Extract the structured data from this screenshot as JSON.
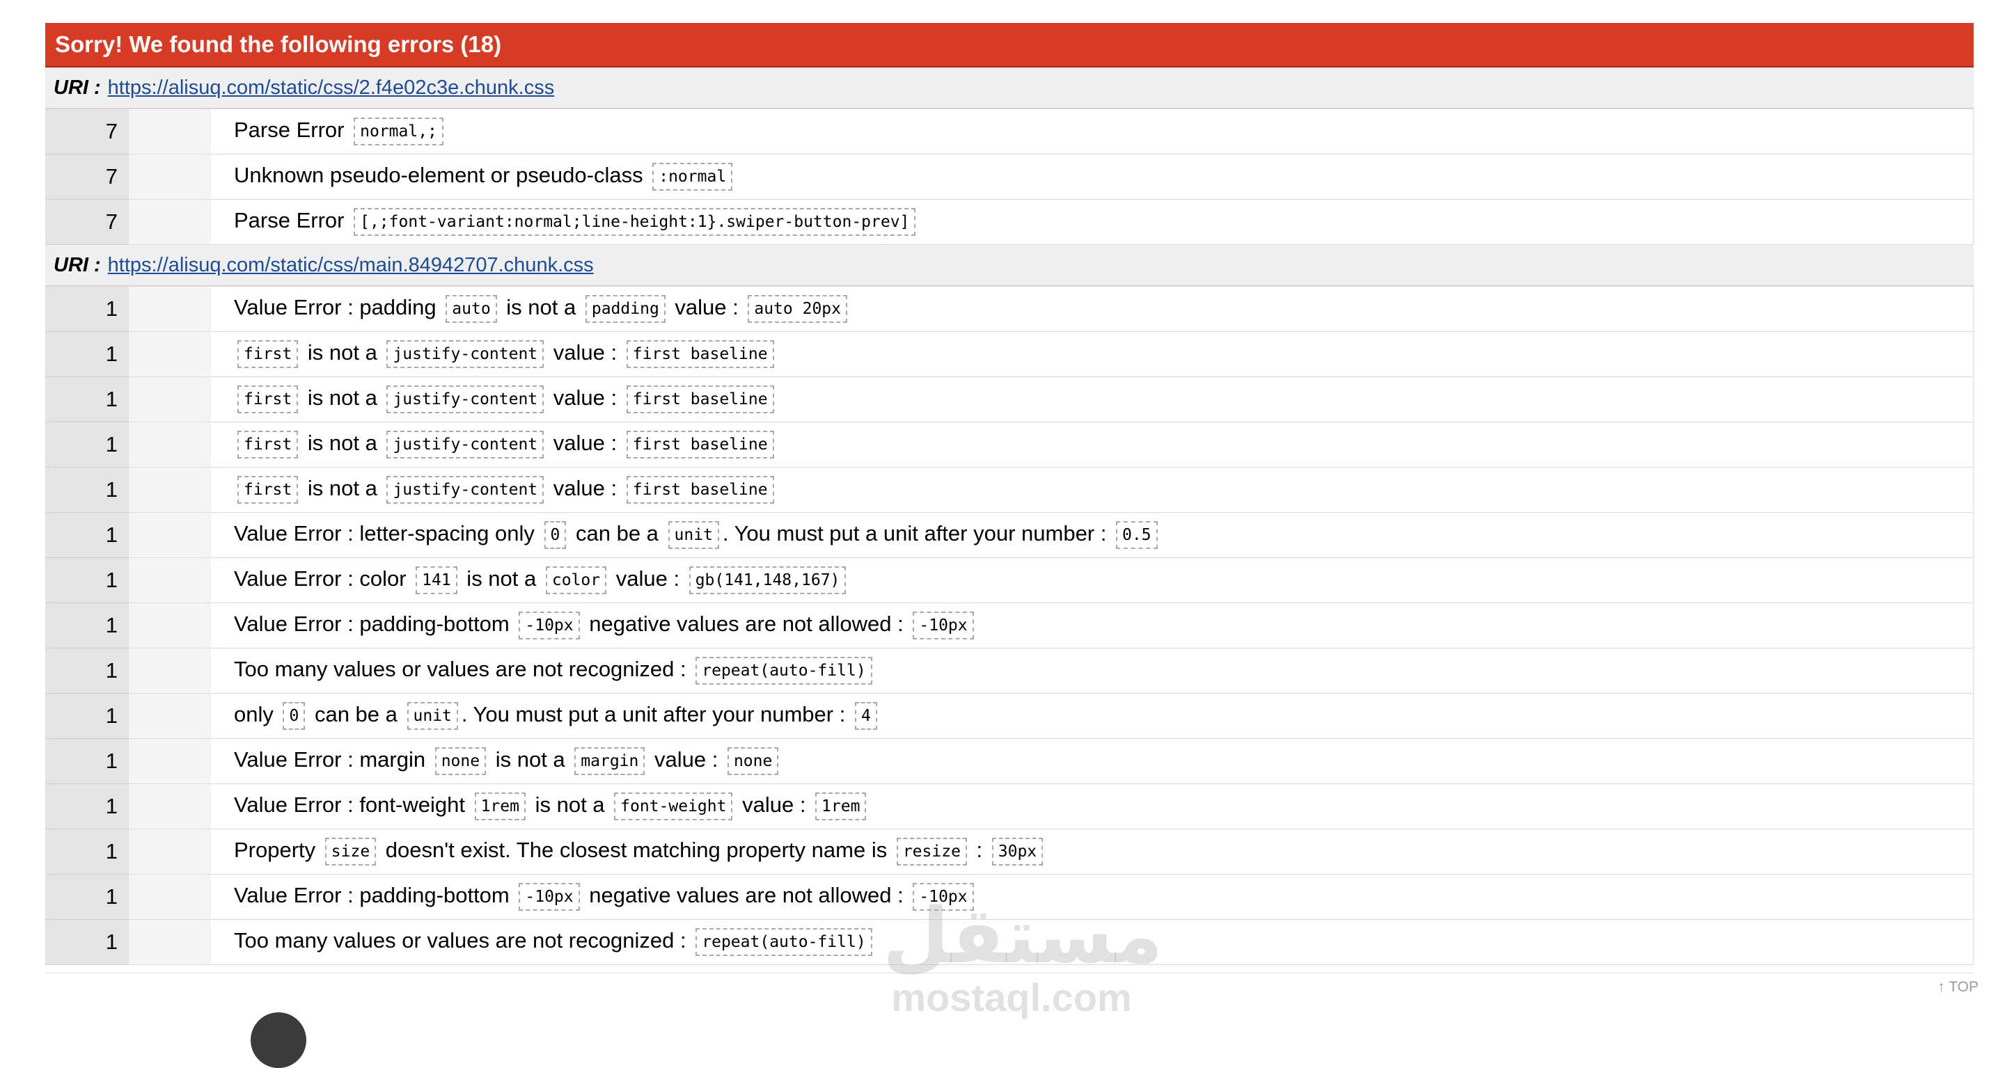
{
  "banner": {
    "title": "Sorry! We found the following errors (18)"
  },
  "uri_label": "URI :",
  "groups": [
    {
      "uri": "https://alisuq.com/static/css/2.f4e02c3e.chunk.css",
      "rows": [
        {
          "line": "7",
          "parts": [
            {
              "t": "Parse Error "
            },
            {
              "c": "normal,;"
            }
          ]
        },
        {
          "line": "7",
          "parts": [
            {
              "t": "Unknown pseudo-element or pseudo-class "
            },
            {
              "c": ":normal"
            }
          ]
        },
        {
          "line": "7",
          "parts": [
            {
              "t": "Parse Error "
            },
            {
              "c": "[,;font-variant:normal;line-height:1}.swiper-button-prev]"
            }
          ]
        }
      ]
    },
    {
      "uri": "https://alisuq.com/static/css/main.84942707.chunk.css",
      "rows": [
        {
          "line": "1",
          "parts": [
            {
              "t": "Value Error : padding "
            },
            {
              "c": "auto"
            },
            {
              "t": " is not a "
            },
            {
              "c": "padding"
            },
            {
              "t": " value : "
            },
            {
              "c": "auto 20px"
            }
          ]
        },
        {
          "line": "1",
          "parts": [
            {
              "c": "first"
            },
            {
              "t": " is not a "
            },
            {
              "c": "justify-content"
            },
            {
              "t": " value : "
            },
            {
              "c": "first baseline"
            }
          ]
        },
        {
          "line": "1",
          "parts": [
            {
              "c": "first"
            },
            {
              "t": " is not a "
            },
            {
              "c": "justify-content"
            },
            {
              "t": " value : "
            },
            {
              "c": "first baseline"
            }
          ]
        },
        {
          "line": "1",
          "parts": [
            {
              "c": "first"
            },
            {
              "t": " is not a "
            },
            {
              "c": "justify-content"
            },
            {
              "t": " value : "
            },
            {
              "c": "first baseline"
            }
          ]
        },
        {
          "line": "1",
          "parts": [
            {
              "c": "first"
            },
            {
              "t": " is not a "
            },
            {
              "c": "justify-content"
            },
            {
              "t": " value : "
            },
            {
              "c": "first baseline"
            }
          ]
        },
        {
          "line": "1",
          "parts": [
            {
              "t": "Value Error : letter-spacing only "
            },
            {
              "c": "0"
            },
            {
              "t": " can be a "
            },
            {
              "c": "unit"
            },
            {
              "t": ". You must put a unit after your number : "
            },
            {
              "c": "0.5"
            }
          ]
        },
        {
          "line": "1",
          "parts": [
            {
              "t": "Value Error : color "
            },
            {
              "c": "141"
            },
            {
              "t": " is not a "
            },
            {
              "c": "color"
            },
            {
              "t": " value : "
            },
            {
              "c": "gb(141,148,167)"
            }
          ]
        },
        {
          "line": "1",
          "parts": [
            {
              "t": "Value Error : padding-bottom "
            },
            {
              "c": "-10px"
            },
            {
              "t": " negative values are not allowed : "
            },
            {
              "c": "-10px"
            }
          ]
        },
        {
          "line": "1",
          "parts": [
            {
              "t": "Too many values or values are not recognized : "
            },
            {
              "c": "repeat(auto-fill)"
            }
          ]
        },
        {
          "line": "1",
          "parts": [
            {
              "t": "only "
            },
            {
              "c": "0"
            },
            {
              "t": " can be a "
            },
            {
              "c": "unit"
            },
            {
              "t": ". You must put a unit after your number : "
            },
            {
              "c": "4"
            }
          ]
        },
        {
          "line": "1",
          "parts": [
            {
              "t": "Value Error : margin "
            },
            {
              "c": "none"
            },
            {
              "t": " is not a "
            },
            {
              "c": "margin"
            },
            {
              "t": " value : "
            },
            {
              "c": "none"
            }
          ]
        },
        {
          "line": "1",
          "parts": [
            {
              "t": "Value Error : font-weight "
            },
            {
              "c": "1rem"
            },
            {
              "t": " is not a "
            },
            {
              "c": "font-weight"
            },
            {
              "t": " value : "
            },
            {
              "c": "1rem"
            }
          ]
        },
        {
          "line": "1",
          "parts": [
            {
              "t": "Property "
            },
            {
              "c": "size"
            },
            {
              "t": " doesn't exist. The closest matching property name is "
            },
            {
              "c": "resize"
            },
            {
              "t": " : "
            },
            {
              "c": "30px"
            }
          ]
        },
        {
          "line": "1",
          "parts": [
            {
              "t": "Value Error : padding-bottom "
            },
            {
              "c": "-10px"
            },
            {
              "t": " negative values are not allowed : "
            },
            {
              "c": "-10px"
            }
          ]
        },
        {
          "line": "1",
          "parts": [
            {
              "t": "Too many values or values are not recognized : "
            },
            {
              "c": "repeat(auto-fill)"
            }
          ]
        }
      ]
    }
  ],
  "footer": {
    "top_link": "↑ TOP"
  },
  "watermark": {
    "arabic": "مستقل",
    "latin": "mostaql.com"
  },
  "colors": {
    "banner_bg": "#d63b25",
    "link": "#1e4b94",
    "row_border": "#f2cfd3"
  }
}
